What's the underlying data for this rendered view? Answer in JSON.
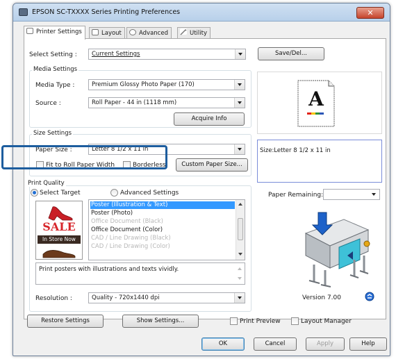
{
  "window": {
    "title": "EPSON SC-TXXXX Series Printing Preferences",
    "close_glyph": "✕"
  },
  "tabs": [
    {
      "label": "Printer Settings"
    },
    {
      "label": "Layout"
    },
    {
      "label": "Advanced"
    },
    {
      "label": "Utility"
    }
  ],
  "select_setting": {
    "label": "Select Setting :",
    "value": "Current Settings",
    "save_label": "Save/Del..."
  },
  "media_settings": {
    "title": "Media Settings",
    "media_type_label": "Media Type :",
    "media_type_value": "Premium Glossy Photo Paper (170)",
    "source_label": "Source :",
    "source_value": "Roll Paper - 44 in (1118 mm)",
    "acquire_label": "Acquire Info"
  },
  "size_settings": {
    "title": "Size Settings",
    "paper_size_label": "Paper Size :",
    "paper_size_value": "Letter 8 1/2 x 11 in",
    "fit_label": "Fit to Roll Paper Width",
    "borderless_label": "Borderless",
    "custom_label": "Custom Paper Size..."
  },
  "preview": {
    "letter": "A",
    "size_text": "Size:Letter 8 1/2 x 11 in",
    "paper_remaining_label": "Paper Remaining:",
    "version": "Version 7.00"
  },
  "print_quality": {
    "title": "Print Quality",
    "select_target_label": "Select Target",
    "advanced_label": "Advanced Settings",
    "sale_text": "SALE",
    "store_text": "In Store Now",
    "targets": [
      {
        "label": "Poster (Illustration & Text)",
        "state": "selected"
      },
      {
        "label": "Poster (Photo)",
        "state": "normal"
      },
      {
        "label": "Office Document (Black)",
        "state": "disabled"
      },
      {
        "label": "Office Document (Color)",
        "state": "normal"
      },
      {
        "label": "CAD / Line Drawing (Black)",
        "state": "disabled"
      },
      {
        "label": "CAD / Line Drawing (Color)",
        "state": "disabled"
      }
    ],
    "description": "Print posters with illustrations and texts vividly.",
    "resolution_label": "Resolution :",
    "resolution_value": "Quality - 720x1440 dpi"
  },
  "bottom": {
    "restore_label": "Restore Settings",
    "show_label": "Show Settings...",
    "print_preview_label": "Print Preview",
    "layout_manager_label": "Layout Manager"
  },
  "dialog": {
    "ok_label": "OK",
    "cancel_label": "Cancel",
    "apply_label": "Apply",
    "help_label": "Help"
  },
  "colors": {
    "highlight": "#1d5d9e",
    "selection": "#3399ff",
    "sale_red": "#d7262b"
  }
}
